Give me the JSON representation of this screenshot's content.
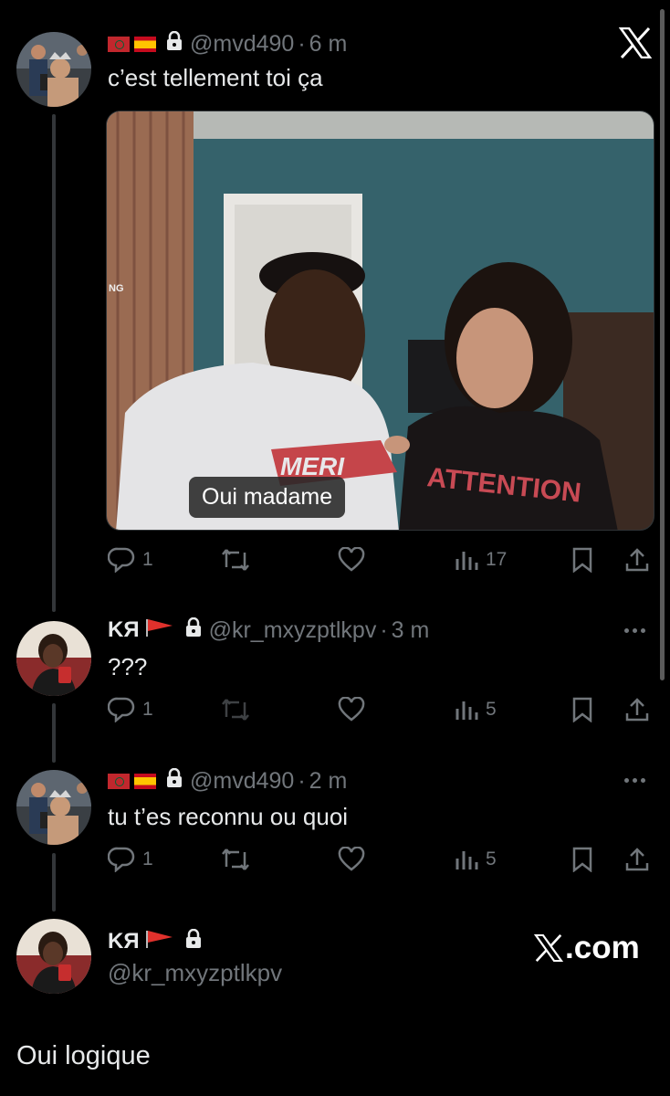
{
  "tweets": [
    {
      "handle": "@mvd490",
      "time": "6 m",
      "text": "c’est tellement toi ça",
      "media_caption": "Oui madame",
      "media_side_text": "NG",
      "media_shirt_left": "MERI",
      "media_shirt_right": "ATTENTION",
      "replies": "1",
      "views": "17"
    },
    {
      "name": "KЯ",
      "handle": "@kr_mxyzptlkpv",
      "time": "3 m",
      "text": "???",
      "replies": "1",
      "views": "5"
    },
    {
      "handle": "@mvd490",
      "time": "2 m",
      "text": "tu t’es reconnu ou quoi",
      "replies": "1",
      "views": "5"
    }
  ],
  "reply_box": {
    "name": "KЯ",
    "handle": "@kr_mxyzptlkpv",
    "text": "Oui logique"
  },
  "brand": {
    "watermark": ".com"
  },
  "separator": "·",
  "colors": {
    "background": "#000000",
    "text": "#e7e9ea",
    "muted": "#71767b",
    "thread_line": "#333639"
  },
  "icons": [
    "reply-icon",
    "retweet-icon",
    "like-icon",
    "views-icon",
    "bookmark-icon",
    "share-icon",
    "lock-icon",
    "x-logo-icon",
    "more-icon"
  ]
}
